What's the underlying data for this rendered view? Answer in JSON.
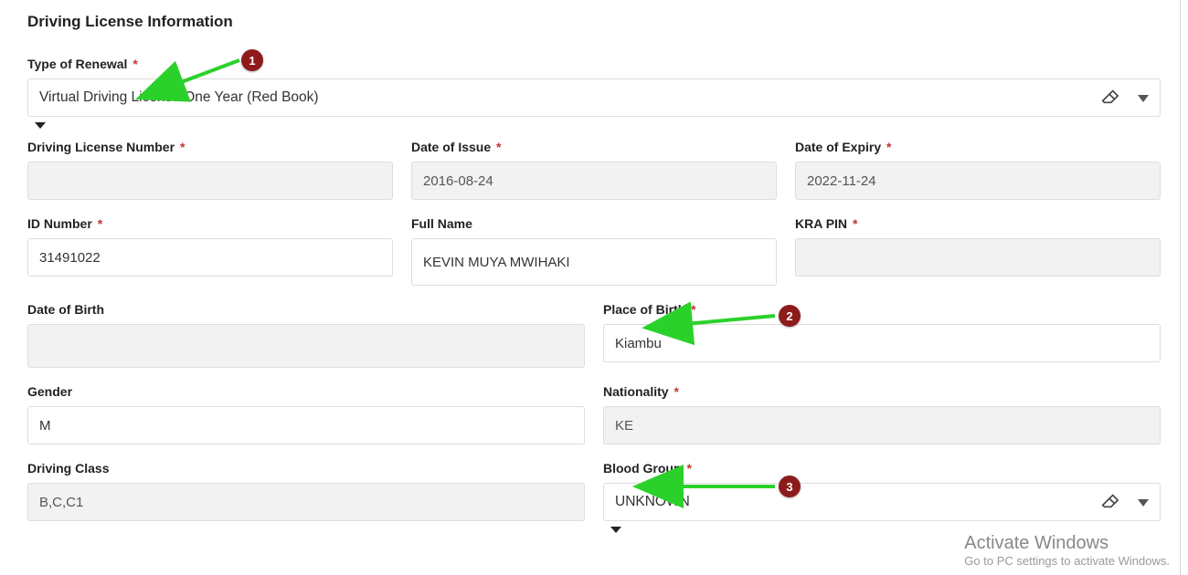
{
  "section_title": "Driving License Information",
  "type_of_renewal": {
    "label": "Type of Renewal",
    "value": "Virtual Driving License One Year (Red Book)"
  },
  "fields_row1": {
    "dl_number": {
      "label": "Driving License Number",
      "value": "        "
    },
    "date_of_issue": {
      "label": "Date of Issue",
      "value": "2016-08-24"
    },
    "date_of_expiry": {
      "label": "Date of Expiry",
      "value": "2022-11-24"
    }
  },
  "fields_row2": {
    "id_number": {
      "label": "ID Number",
      "value": "31491022"
    },
    "full_name": {
      "label": "Full Name",
      "value": "KEVIN MUYA MWIHAKI"
    },
    "kra_pin": {
      "label": "KRA PIN",
      "value": ""
    }
  },
  "fields_row3": {
    "dob": {
      "label": "Date of Birth",
      "value": "          "
    },
    "pob": {
      "label": "Place of Birth",
      "value": "Kiambu"
    }
  },
  "fields_row4": {
    "gender": {
      "label": "Gender",
      "value": "M"
    },
    "nationality": {
      "label": "Nationality",
      "value": "KE"
    }
  },
  "fields_row5": {
    "dclass": {
      "label": "Driving Class",
      "value": "B,C,C1"
    },
    "blood": {
      "label": "Blood Group",
      "value": "UNKNOWN"
    }
  },
  "activate": {
    "line1": "Activate Windows",
    "line2": "Go to PC settings to activate Windows."
  },
  "annotations": {
    "b1": "1",
    "b2": "2",
    "b3": "3"
  }
}
